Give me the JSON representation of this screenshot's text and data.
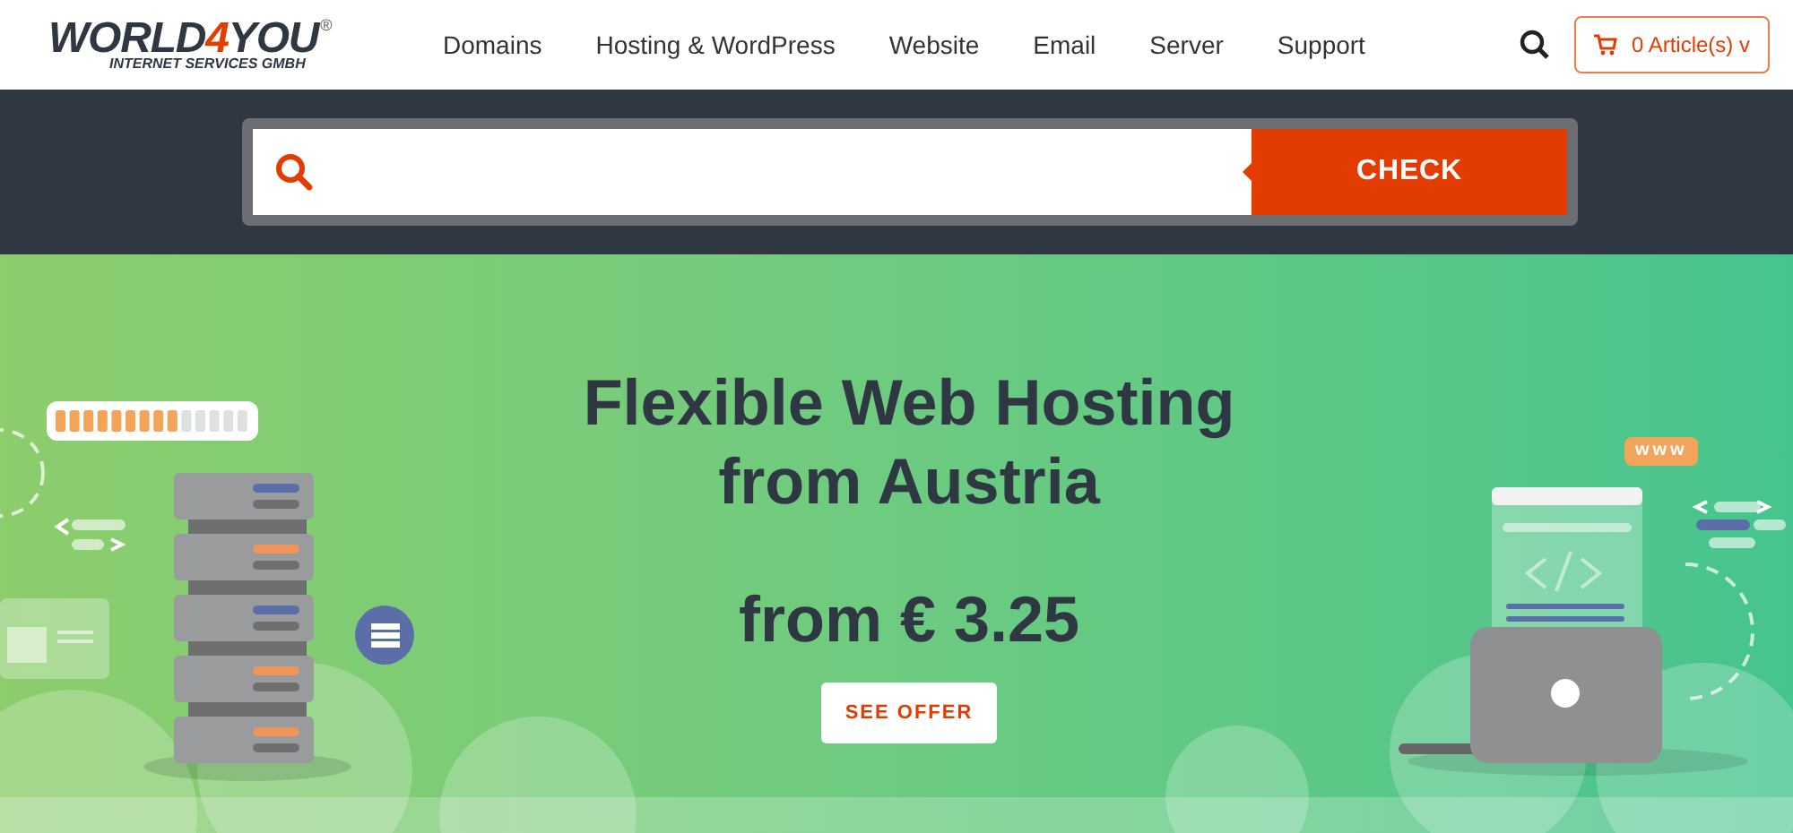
{
  "logo": {
    "parts": [
      {
        "text": "WORLD",
        "accent": false
      },
      {
        "text": "4",
        "accent": true
      },
      {
        "text": "YOU",
        "accent": false
      }
    ],
    "registered": "®",
    "tagline": "INTERNET SERVICES GMBH"
  },
  "nav": [
    "Domains",
    "Hosting & WordPress",
    "Website",
    "Email",
    "Server",
    "Support"
  ],
  "cart": {
    "label": "0 Article(s)",
    "caret": "v"
  },
  "domain_search": {
    "button": "CHECK"
  },
  "hero": {
    "title_lines": [
      "Flexible Web Hosting",
      "from Austria"
    ],
    "price": "from € 3.25",
    "cta": "SEE OFFER",
    "badge": "www"
  }
}
